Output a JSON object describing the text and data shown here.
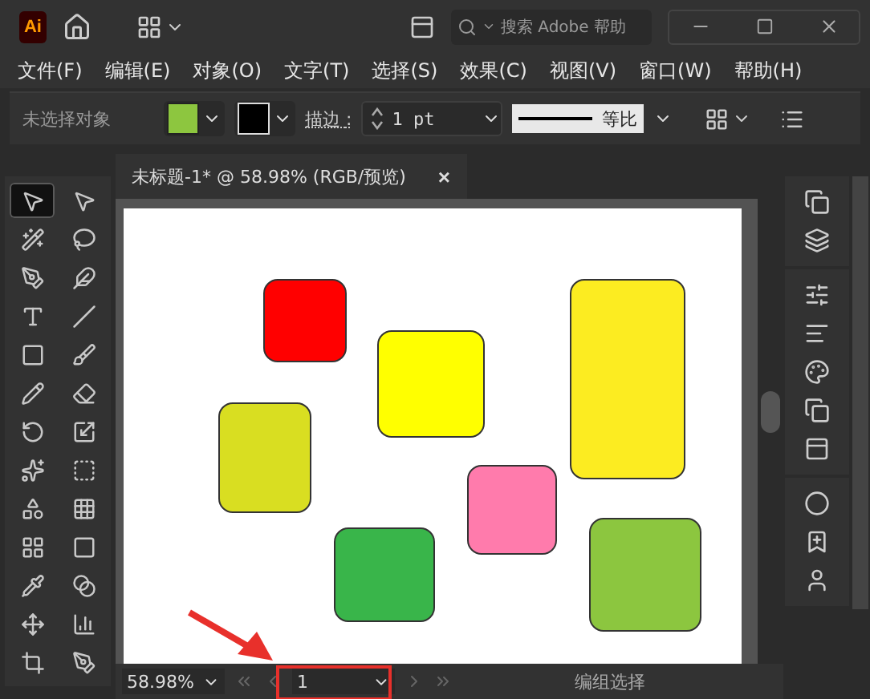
{
  "app": {
    "logo": "Ai",
    "search_placeholder": "搜索 Adobe 帮助"
  },
  "menu": [
    "文件(F)",
    "编辑(E)",
    "对象(O)",
    "文字(T)",
    "选择(S)",
    "效果(C)",
    "视图(V)",
    "窗口(W)",
    "帮助(H)"
  ],
  "control_bar": {
    "selection": "未选择对象",
    "stroke_label": "描边",
    "stroke_colon": ":",
    "stroke_weight": "1 pt",
    "profile": "等比"
  },
  "document_tab": {
    "title": "未标题-1* @ 58.98% (RGB/预览)",
    "close": "×"
  },
  "tools": [
    {
      "selected": true
    },
    {
      "selected": false
    },
    {
      "selected": false
    },
    {
      "selected": false
    },
    {
      "selected": false
    },
    {
      "selected": false
    },
    {
      "selected": false
    },
    {
      "selected": false
    },
    {
      "selected": false
    },
    {
      "selected": false
    },
    {
      "selected": false
    },
    {
      "selected": false
    },
    {
      "selected": false
    },
    {
      "selected": false
    },
    {
      "selected": false
    },
    {
      "selected": false
    },
    {
      "selected": false
    },
    {
      "selected": false
    },
    {
      "selected": false
    },
    {
      "selected": false
    },
    {
      "selected": false
    },
    {
      "selected": false
    },
    {
      "selected": false
    },
    {
      "selected": false
    },
    {
      "selected": false
    },
    {
      "selected": false
    }
  ],
  "shapes": [
    {
      "color": "#ff0000"
    },
    {
      "color": "#ffff00"
    },
    {
      "color": "#fcec21"
    },
    {
      "color": "#d9de21"
    },
    {
      "color": "#ff7bac"
    },
    {
      "color": "#39b54a"
    },
    {
      "color": "#8cc63f"
    }
  ],
  "status_bar": {
    "zoom": "58.98%",
    "artboard": "1",
    "tool": "编组选择"
  }
}
